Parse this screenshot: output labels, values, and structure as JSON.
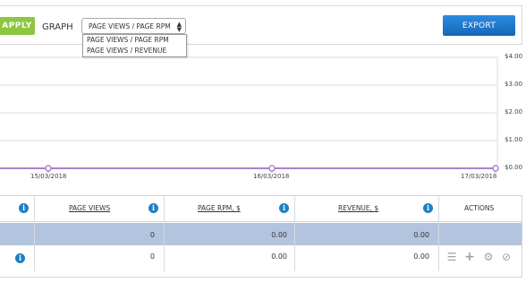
{
  "toolbar": {
    "apply_label": "APPLY",
    "graph_label": "GRAPH",
    "graph_select_value": "PAGE VIEWS / PAGE RPM",
    "graph_options": [
      "PAGE VIEWS / PAGE RPM",
      "PAGE VIEWS / REVENUE"
    ],
    "export_label": "EXPORT"
  },
  "chart_data": {
    "type": "line",
    "title": "",
    "xlabel": "",
    "ylabel": "",
    "categories": [
      "15/03/2018",
      "16/03/2018",
      "17/03/2018"
    ],
    "series": [
      {
        "values": [
          0,
          0,
          0
        ],
        "color": "#b07fd0"
      }
    ],
    "yticks": [
      "$4.00",
      "$3.00",
      "$2.00",
      "$1.00",
      "$0.00"
    ],
    "ylim": [
      0,
      4
    ],
    "grid": true,
    "legend": "none"
  },
  "table": {
    "headers": [
      "PAGE VIEWS",
      "PAGE RPM, $",
      "REVENUE, $",
      "ACTIONS"
    ],
    "total_row": {
      "page_views": "0",
      "page_rpm": "0.00",
      "revenue": "0.00"
    },
    "rows": [
      {
        "page_views": "0",
        "page_rpm": "0.00",
        "revenue": "0.00"
      }
    ],
    "action_icons": [
      "list-icon",
      "plus-icon",
      "gear-icon",
      "block-icon"
    ]
  }
}
